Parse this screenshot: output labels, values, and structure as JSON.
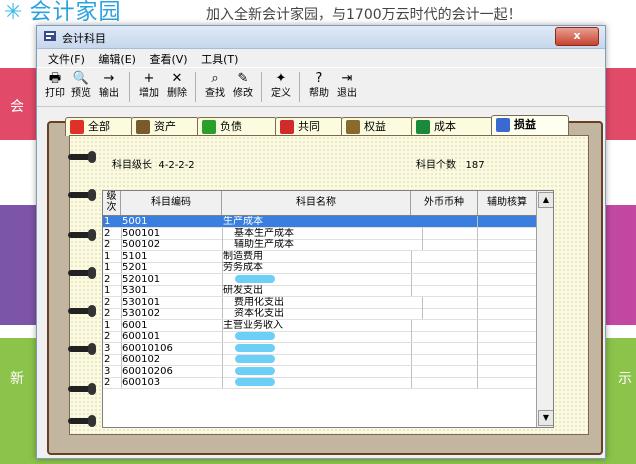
{
  "background": {
    "logo": "会计家园",
    "slogan": "加入全新会计家园，与1700万云时代的会计一起！",
    "side_text_left_1": "会",
    "side_text_left_2": "新",
    "side_text_right": "示"
  },
  "window": {
    "title": "会计科目",
    "close_label": "x"
  },
  "menu": [
    "文件(F)",
    "编辑(E)",
    "查看(V)",
    "工具(T)"
  ],
  "toolbar": [
    {
      "label": "打印",
      "icon": "🖶"
    },
    {
      "label": "预览",
      "icon": "🔍"
    },
    {
      "label": "输出",
      "icon": "→"
    },
    {
      "label": "增加",
      "icon": "+"
    },
    {
      "label": "删除",
      "icon": "✕"
    },
    {
      "label": "查找",
      "icon": "⌕"
    },
    {
      "label": "修改",
      "icon": "✎"
    },
    {
      "label": "定义",
      "icon": "✦"
    },
    {
      "label": "帮助",
      "icon": "?"
    },
    {
      "label": "退出",
      "icon": "⇥"
    }
  ],
  "tabs": [
    {
      "label": "全部",
      "color": "#e0302a"
    },
    {
      "label": "资产",
      "color": "#7a5a2a"
    },
    {
      "label": "负债",
      "color": "#2aa02a"
    },
    {
      "label": "共同",
      "color": "#d02a2a"
    },
    {
      "label": "权益",
      "color": "#8a6a2a"
    },
    {
      "label": "成本",
      "color": "#1a8a3a"
    },
    {
      "label": "损益",
      "color": "#3a6ad0"
    }
  ],
  "active_tab": "损益",
  "info": {
    "level_label": "科目级长",
    "level_value": "4-2-2-2",
    "count_label": "科目个数",
    "count_value": "187"
  },
  "grid": {
    "headers": [
      "级次",
      "科目编码",
      "科目名称",
      "外币币种",
      "辅助核算"
    ],
    "rows": [
      {
        "level": "1",
        "code": "5001",
        "name": "生产成本",
        "selected": true
      },
      {
        "level": "2",
        "code": "500101",
        "name": "基本生产成本",
        "indent": true
      },
      {
        "level": "2",
        "code": "500102",
        "name": "辅助生产成本",
        "indent": true
      },
      {
        "level": "1",
        "code": "5101",
        "name": "制造费用"
      },
      {
        "level": "1",
        "code": "5201",
        "name": "劳务成本"
      },
      {
        "level": "2",
        "code": "520101",
        "name": "",
        "blurred": true
      },
      {
        "level": "1",
        "code": "5301",
        "name": "研发支出"
      },
      {
        "level": "2",
        "code": "530101",
        "name": "费用化支出",
        "indent": true
      },
      {
        "level": "2",
        "code": "530102",
        "name": "资本化支出",
        "indent": true
      },
      {
        "level": "1",
        "code": "6001",
        "name": "主营业务收入"
      },
      {
        "level": "2",
        "code": "600101",
        "name": "",
        "blurred": true
      },
      {
        "level": "3",
        "code": "60010106",
        "name": "",
        "blurred": true
      },
      {
        "level": "2",
        "code": "600102",
        "name": "",
        "blurred": true
      },
      {
        "level": "3",
        "code": "60010206",
        "name": "",
        "blurred": true
      },
      {
        "level": "2",
        "code": "600103",
        "name": "",
        "blurred": true
      }
    ]
  }
}
